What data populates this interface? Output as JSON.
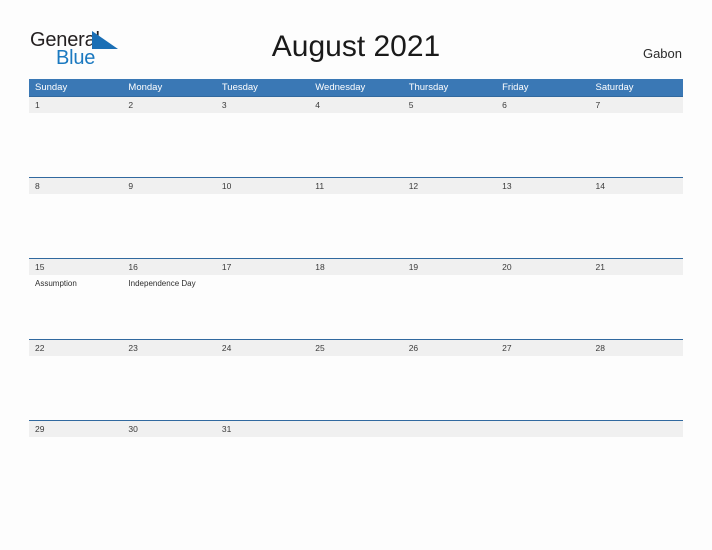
{
  "header": {
    "logo": {
      "word_one": "General",
      "word_two": "Blue",
      "flag_icon": "blue-flag-triangle-icon",
      "word_one_color": "#231f20",
      "word_two_color": "#1b79c0",
      "flag_color": "#1b6fb5"
    },
    "title": "August 2021",
    "country": "Gabon"
  },
  "calendar": {
    "accent_color": "#3a78b5",
    "row_line_color": "#31699f",
    "date_band_color": "#f0f0f0",
    "weekdays": [
      "Sunday",
      "Monday",
      "Tuesday",
      "Wednesday",
      "Thursday",
      "Friday",
      "Saturday"
    ],
    "weeks": [
      {
        "days": [
          {
            "date": "1",
            "event": ""
          },
          {
            "date": "2",
            "event": ""
          },
          {
            "date": "3",
            "event": ""
          },
          {
            "date": "4",
            "event": ""
          },
          {
            "date": "5",
            "event": ""
          },
          {
            "date": "6",
            "event": ""
          },
          {
            "date": "7",
            "event": ""
          }
        ]
      },
      {
        "days": [
          {
            "date": "8",
            "event": ""
          },
          {
            "date": "9",
            "event": ""
          },
          {
            "date": "10",
            "event": ""
          },
          {
            "date": "11",
            "event": ""
          },
          {
            "date": "12",
            "event": ""
          },
          {
            "date": "13",
            "event": ""
          },
          {
            "date": "14",
            "event": ""
          }
        ]
      },
      {
        "days": [
          {
            "date": "15",
            "event": "Assumption"
          },
          {
            "date": "16",
            "event": "Independence Day"
          },
          {
            "date": "17",
            "event": ""
          },
          {
            "date": "18",
            "event": ""
          },
          {
            "date": "19",
            "event": ""
          },
          {
            "date": "20",
            "event": ""
          },
          {
            "date": "21",
            "event": ""
          }
        ]
      },
      {
        "days": [
          {
            "date": "22",
            "event": ""
          },
          {
            "date": "23",
            "event": ""
          },
          {
            "date": "24",
            "event": ""
          },
          {
            "date": "25",
            "event": ""
          },
          {
            "date": "26",
            "event": ""
          },
          {
            "date": "27",
            "event": ""
          },
          {
            "date": "28",
            "event": ""
          }
        ]
      },
      {
        "days": [
          {
            "date": "29",
            "event": ""
          },
          {
            "date": "30",
            "event": ""
          },
          {
            "date": "31",
            "event": ""
          },
          {
            "date": "",
            "event": ""
          },
          {
            "date": "",
            "event": ""
          },
          {
            "date": "",
            "event": ""
          },
          {
            "date": "",
            "event": ""
          }
        ]
      }
    ]
  }
}
